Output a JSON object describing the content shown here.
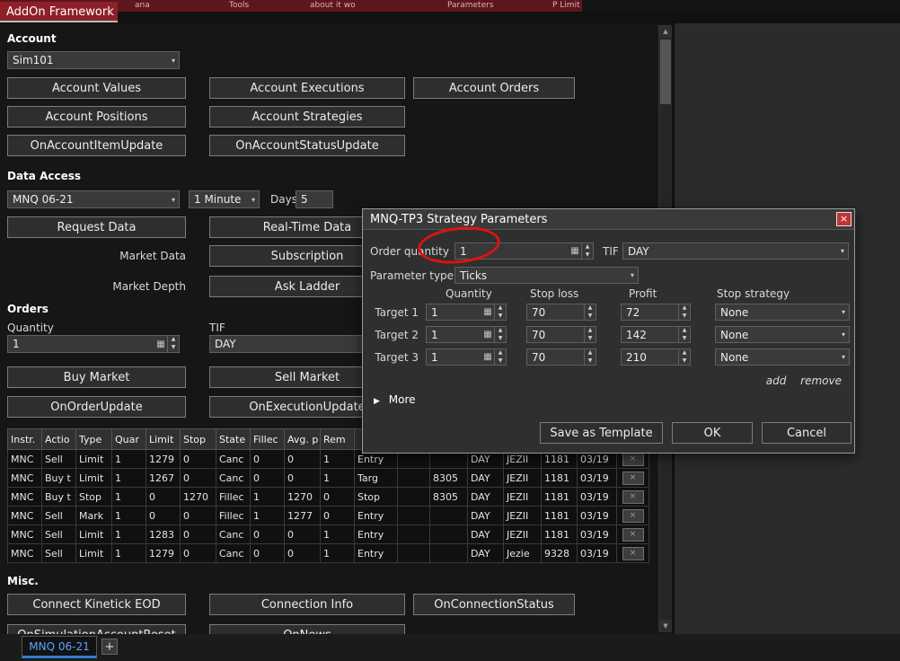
{
  "window": {
    "tab_title": "AddOn Framework",
    "top_fragments": [
      "ana",
      "Tools",
      "about it wo",
      "Parameters",
      "P Limit"
    ]
  },
  "icons": {
    "chevron_down": "▾",
    "calculator": "▦",
    "spin_up": "▲",
    "spin_down": "▼",
    "close": "×",
    "more_arrow": "▶",
    "scroll_up": "▲",
    "scroll_down": "▼"
  },
  "account": {
    "label": "Account",
    "selected_account": "Sim101",
    "values": "Account Values",
    "executions": "Account Executions",
    "orders": "Account Orders",
    "positions": "Account Positions",
    "strategies": "Account Strategies",
    "item_update": "OnAccountItemUpdate",
    "status_update": "OnAccountStatusUpdate"
  },
  "data_access": {
    "label": "Data Access",
    "instrument": "MNQ 06-21",
    "interval": "1 Minute",
    "days_label": "Days",
    "days_value": "5",
    "request_data": "Request Data",
    "realtime_data": "Real-Time Data",
    "market_data_label": "Market Data",
    "subscription": "Subscription",
    "market_depth_label": "Market Depth",
    "ask_ladder": "Ask Ladder"
  },
  "orders": {
    "label": "Orders",
    "quantity_label": "Quantity",
    "quantity_value": "1",
    "tif_label": "TIF",
    "tif_value": "DAY",
    "buy_market": "Buy Market",
    "sell_market": "Sell Market",
    "on_order_update": "OnOrderUpdate",
    "on_execution_update": "OnExecutionUpdate"
  },
  "orders_table": {
    "headers": [
      "Instr.",
      "Actio",
      "Type",
      "Quar",
      "Limit",
      "Stop",
      "State",
      "Fillec",
      "Avg. p",
      "Rem",
      "",
      "",
      "",
      "",
      "",
      "",
      ""
    ],
    "rows": [
      [
        "MNC",
        "Sell",
        "Limit",
        "1",
        "1279",
        "0",
        "Canc",
        "0",
        "0",
        "1",
        "Entry",
        "",
        "",
        "DAY",
        "JEZII",
        "1181",
        "03/19"
      ],
      [
        "MNC",
        "Buy t",
        "Limit",
        "1",
        "1267",
        "0",
        "Canc",
        "0",
        "0",
        "1",
        "Targ",
        "",
        "8305",
        "DAY",
        "JEZII",
        "1181",
        "03/19"
      ],
      [
        "MNC",
        "Buy t",
        "Stop",
        "1",
        "0",
        "1270",
        "Fillec",
        "1",
        "1270",
        "0",
        "Stop",
        "",
        "8305",
        "DAY",
        "JEZII",
        "1181",
        "03/19"
      ],
      [
        "MNC",
        "Sell",
        "Mark",
        "1",
        "0",
        "0",
        "Fillec",
        "1",
        "1277",
        "0",
        "Entry",
        "",
        "",
        "DAY",
        "JEZII",
        "1181",
        "03/19"
      ],
      [
        "MNC",
        "Sell",
        "Limit",
        "1",
        "1283",
        "0",
        "Canc",
        "0",
        "0",
        "1",
        "Entry",
        "",
        "",
        "DAY",
        "JEZII",
        "1181",
        "03/19"
      ],
      [
        "MNC",
        "Sell",
        "Limit",
        "1",
        "1279",
        "0",
        "Canc",
        "0",
        "0",
        "1",
        "Entry",
        "",
        "",
        "DAY",
        "Jezie",
        "9328",
        "03/19"
      ]
    ],
    "remove_symbol": "×"
  },
  "misc": {
    "label": "Misc.",
    "connect_kinetick": "Connect Kinetick EOD",
    "connection_info": "Connection Info",
    "on_connection_status": "OnConnectionStatus",
    "on_simulation_reset": "OnSimulationAccountReset",
    "on_news": "OnNews"
  },
  "dialog": {
    "title": "MNQ-TP3 Strategy Parameters",
    "order_quantity_label": "Order quantity",
    "order_quantity_value": "1",
    "tif_label": "TIF",
    "tif_value": "DAY",
    "parameter_type_label": "Parameter type",
    "parameter_type_value": "Ticks",
    "columns": [
      "Quantity",
      "Stop loss",
      "Profit",
      "Stop strategy"
    ],
    "targets": [
      {
        "label": "Target 1",
        "quantity": "1",
        "stop_loss": "70",
        "profit": "72",
        "strategy": "None"
      },
      {
        "label": "Target 2",
        "quantity": "1",
        "stop_loss": "70",
        "profit": "142",
        "strategy": "None"
      },
      {
        "label": "Target 3",
        "quantity": "1",
        "stop_loss": "70",
        "profit": "210",
        "strategy": "None"
      }
    ],
    "add_link": "add",
    "remove_link": "remove",
    "more_label": "More",
    "save_template": "Save as Template",
    "ok": "OK",
    "cancel": "Cancel"
  },
  "bottom": {
    "tab": "MNQ 06-21",
    "add": "+"
  },
  "colors": {
    "accent_red": "#8e2029",
    "tab_blue": "#58a6ff",
    "annotation_red": "#e01212"
  }
}
